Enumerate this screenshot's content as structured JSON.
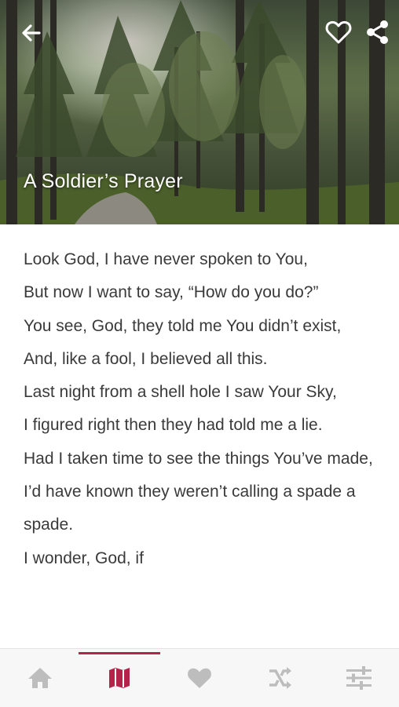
{
  "header": {
    "title": "A Soldier’s Prayer",
    "back_icon": "arrow-left-icon",
    "favorite_icon": "heart-outline-icon",
    "share_icon": "share-icon"
  },
  "poem": {
    "lines": [
      "Look God, I have never spoken to You,",
      "But now I want to say, “How do you do?”",
      "You see, God, they told me You didn’t exist,",
      "And, like a fool, I believed all this.",
      "Last night from a shell hole I saw Your Sky,",
      "I figured right then they had told me a lie.",
      "Had I taken time to see the things You’ve made,",
      "I’d have known they weren’t calling a spade a spade.",
      "I wonder, God, if"
    ]
  },
  "bottom_nav": {
    "items": [
      {
        "icon": "home-icon",
        "active": false
      },
      {
        "icon": "map-icon",
        "active": true
      },
      {
        "icon": "heart-icon",
        "active": false
      },
      {
        "icon": "shuffle-icon",
        "active": false
      },
      {
        "icon": "settings-sliders-icon",
        "active": false
      }
    ]
  },
  "colors": {
    "accent": "#b5224a",
    "inactive_icon": "#bdbdbd",
    "text": "#3a3a3a",
    "nav_bg": "#f7f7f7"
  }
}
